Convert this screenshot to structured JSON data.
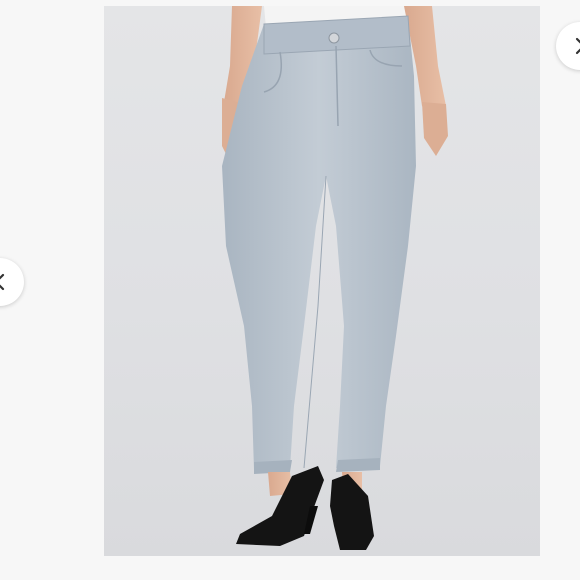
{
  "gallery": {
    "image_subject": "light-wash-skinny-jeans-product-photo",
    "prev_icon": "chevron-left-icon",
    "next_icon": "chevron-right-icon"
  },
  "colors": {
    "page_background": "#f7f7f7",
    "photo_background": "#e0e1e4",
    "denim": "#b9c4ce",
    "shoe": "#141414"
  }
}
